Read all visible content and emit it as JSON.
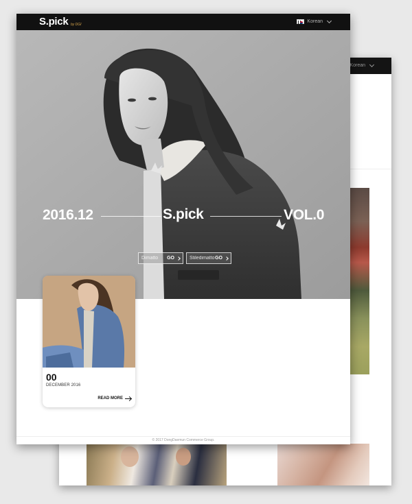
{
  "back_page": {
    "language": "Korean"
  },
  "header": {
    "logo": "S.pick",
    "logo_sub": "by DGI",
    "language": "Korean",
    "flag_icon": "korea-flag-icon"
  },
  "hero": {
    "date": "2016.12",
    "brand": "S.pick",
    "volume": "VOL.0",
    "buttons": [
      {
        "label": "Dimatto",
        "go": "GO"
      },
      {
        "label": "Stiledimatto",
        "go": "GO"
      }
    ]
  },
  "card": {
    "number": "00",
    "date": "DECEMBER 2016",
    "read_more": "READ MORE"
  },
  "footer": {
    "copyright": "© 2017 DongDaemun Commerce Group."
  }
}
